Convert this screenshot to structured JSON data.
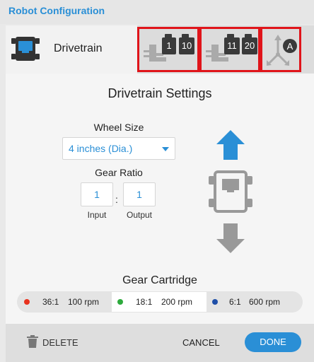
{
  "window": {
    "title": "Robot Configuration"
  },
  "tabs": {
    "main": {
      "label": "Drivetrain",
      "icon": "drivetrain-brain-icon"
    },
    "motor_group_left": {
      "icon": "motor-icon",
      "ports": [
        "1",
        "10"
      ]
    },
    "motor_group_right": {
      "icon": "motor-icon",
      "ports": [
        "11",
        "20"
      ]
    },
    "gyro": {
      "icon": "gyro-sensor-icon",
      "badge": "A"
    }
  },
  "settings": {
    "title": "Drivetrain Settings",
    "wheel_size": {
      "label": "Wheel Size",
      "value": "4 inches (Dia.)"
    },
    "gear_ratio": {
      "label": "Gear Ratio",
      "input": "1",
      "output": "1",
      "separator": ":",
      "input_label": "Input",
      "output_label": "Output"
    }
  },
  "preview": {
    "forward_icon": "arrow-up-icon",
    "robot_icon": "robot-top-view-icon",
    "reverse_icon": "arrow-down-icon"
  },
  "gear_cartridge": {
    "title": "Gear Cartridge",
    "options": [
      {
        "ratio": "36:1",
        "rpm": "100 rpm",
        "color": "#e8321e"
      },
      {
        "ratio": "18:1",
        "rpm": "200 rpm",
        "color": "#2daa3c",
        "selected": true
      },
      {
        "ratio": "6:1",
        "rpm": "600 rpm",
        "color": "#1f4fa8"
      }
    ]
  },
  "footer": {
    "delete_label": "DELETE",
    "cancel_label": "CANCEL",
    "done_label": "DONE"
  },
  "colors": {
    "accent": "#2a8fd6",
    "highlight_border": "#e0141a"
  }
}
